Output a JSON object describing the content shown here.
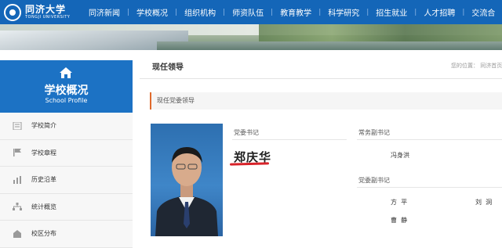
{
  "header": {
    "logo_cn": "同济大学",
    "logo_en": "TONGJI UNIVERSITY",
    "nav": [
      "同济新闻",
      "学校概况",
      "组织机构",
      "师资队伍",
      "教育教学",
      "科学研究",
      "招生就业",
      "人才招聘",
      "交流合"
    ]
  },
  "sidebar": {
    "title": "学校概况",
    "subtitle": "School Profile",
    "items": [
      {
        "label": "学校简介",
        "icon": "document-icon"
      },
      {
        "label": "学校章程",
        "icon": "flag-icon"
      },
      {
        "label": "历史沿革",
        "icon": "bar-chart-icon"
      },
      {
        "label": "统计概览",
        "icon": "network-icon"
      },
      {
        "label": "校区分布",
        "icon": "building-icon"
      }
    ]
  },
  "main": {
    "page_title": "现任领导",
    "breadcrumb": "您的位置：  同济首页",
    "section_title": "现任党委领导",
    "secretary": {
      "role": "党委书记",
      "name": "郑庆华"
    },
    "exec_deputy": {
      "role": "常务副书记",
      "name": "冯身洪"
    },
    "deputies": {
      "role": "党委副书记",
      "names": [
        "方  平",
        "刘  洞",
        "曹  静"
      ]
    }
  },
  "colors": {
    "nav_bg": "#1466b8",
    "sidebar_head": "#1c72c4",
    "accent": "#e06a2c",
    "underline": "#d8232a"
  }
}
